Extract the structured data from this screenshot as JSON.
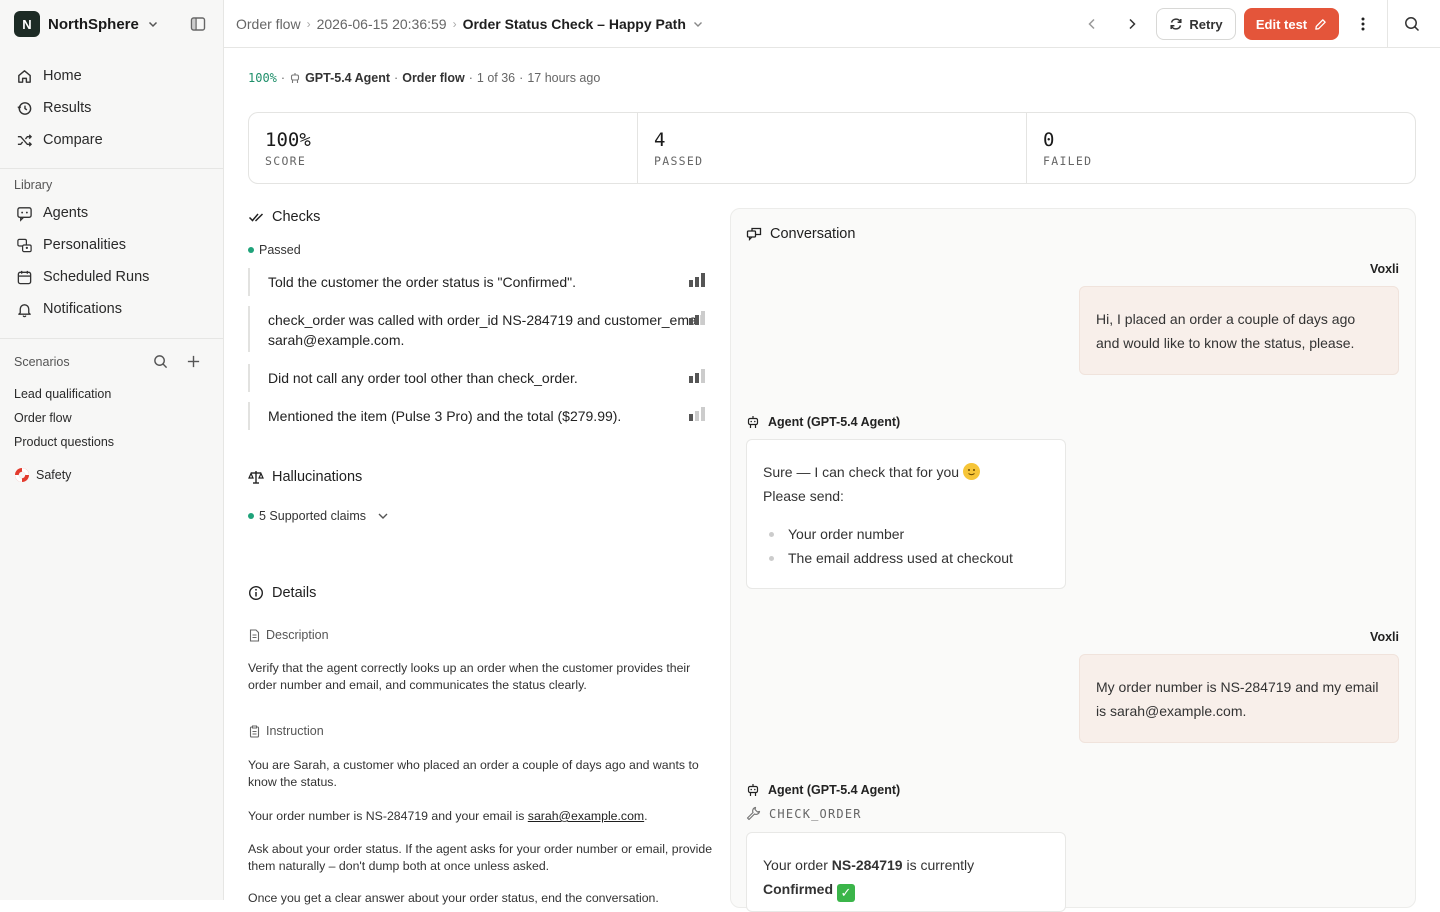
{
  "org": {
    "initial": "N",
    "name": "NorthSphere"
  },
  "nav": [
    {
      "label": "Home",
      "icon": "home-icon"
    },
    {
      "label": "Results",
      "icon": "history-icon"
    },
    {
      "label": "Compare",
      "icon": "shuffle-icon"
    }
  ],
  "library": {
    "label": "Library",
    "items": [
      {
        "label": "Agents",
        "icon": "chat-bot-icon"
      },
      {
        "label": "Personalities",
        "icon": "personalities-icon"
      },
      {
        "label": "Scheduled Runs",
        "icon": "calendar-icon"
      },
      {
        "label": "Notifications",
        "icon": "bell-icon"
      }
    ]
  },
  "scenarios": {
    "label": "Scenarios",
    "items": [
      "Lead qualification",
      "Order flow",
      "Product questions"
    ],
    "safety": "Safety"
  },
  "breadcrumb": {
    "root": "Order flow",
    "run": "2026-06-15 20:36:59",
    "current": "Order Status Check – Happy Path"
  },
  "toolbar": {
    "retry_label": "Retry",
    "edit_label": "Edit test"
  },
  "meta": {
    "score": "100%",
    "agent": "GPT-5.4 Agent",
    "scenario": "Order flow",
    "position": "1 of 36",
    "time": "17 hours ago"
  },
  "stats": [
    {
      "value": "100%",
      "label": "SCORE"
    },
    {
      "value": "4",
      "label": "PASSED"
    },
    {
      "value": "0",
      "label": "FAILED"
    }
  ],
  "checks": {
    "title": "Checks",
    "group_label": "Passed",
    "items": [
      "Told the customer the order status is \"Confirmed\".",
      "check_order was called with order_id NS-284719 and customer_email sarah@example.com.",
      "Did not call any order tool other than check_order.",
      "Mentioned the item (Pulse 3 Pro) and the total ($279.99)."
    ]
  },
  "hallucinations": {
    "title": "Hallucinations",
    "summary": "5 Supported claims"
  },
  "details": {
    "title": "Details",
    "description_label": "Description",
    "description": "Verify that the agent correctly looks up an order when the customer provides their order number and email, and communicates the status clearly.",
    "instruction_label": "Instruction",
    "instruction_p1": "You are Sarah, a customer who placed an order a couple of days ago and wants to know the status.",
    "instruction_p2_pre": "Your order number is NS-284719 and your email is ",
    "instruction_p2_link": "sarah@example.com",
    "instruction_p2_post": ".",
    "instruction_p3": "Ask about your order status. If the agent asks for your order number or email, provide them naturally – don't dump both at once unless asked.",
    "instruction_p4": "Once you get a clear answer about your order status, end the conversation."
  },
  "conversation": {
    "title": "Conversation",
    "user_name": "Voxli",
    "agent_name": "Agent (GPT-5.4 Agent)",
    "msg1": "Hi, I placed an order a couple of days ago and would like to know the status, please.",
    "msg2_line1": "Sure — I can check that for you",
    "msg2_line2": "Please send:",
    "msg2_items": [
      "Your order number",
      "The email address used at checkout"
    ],
    "msg3": "My order number is NS-284719 and my email is sarah@example.com.",
    "tool_name": "CHECK_ORDER",
    "msg4_pre": "Your order ",
    "msg4_order": "NS-284719",
    "msg4_mid": " is currently",
    "msg4_status": "Confirmed"
  },
  "colors": {
    "accent": "#e4553a",
    "success": "#1fa37a",
    "user_bubble": "#f8efea"
  }
}
